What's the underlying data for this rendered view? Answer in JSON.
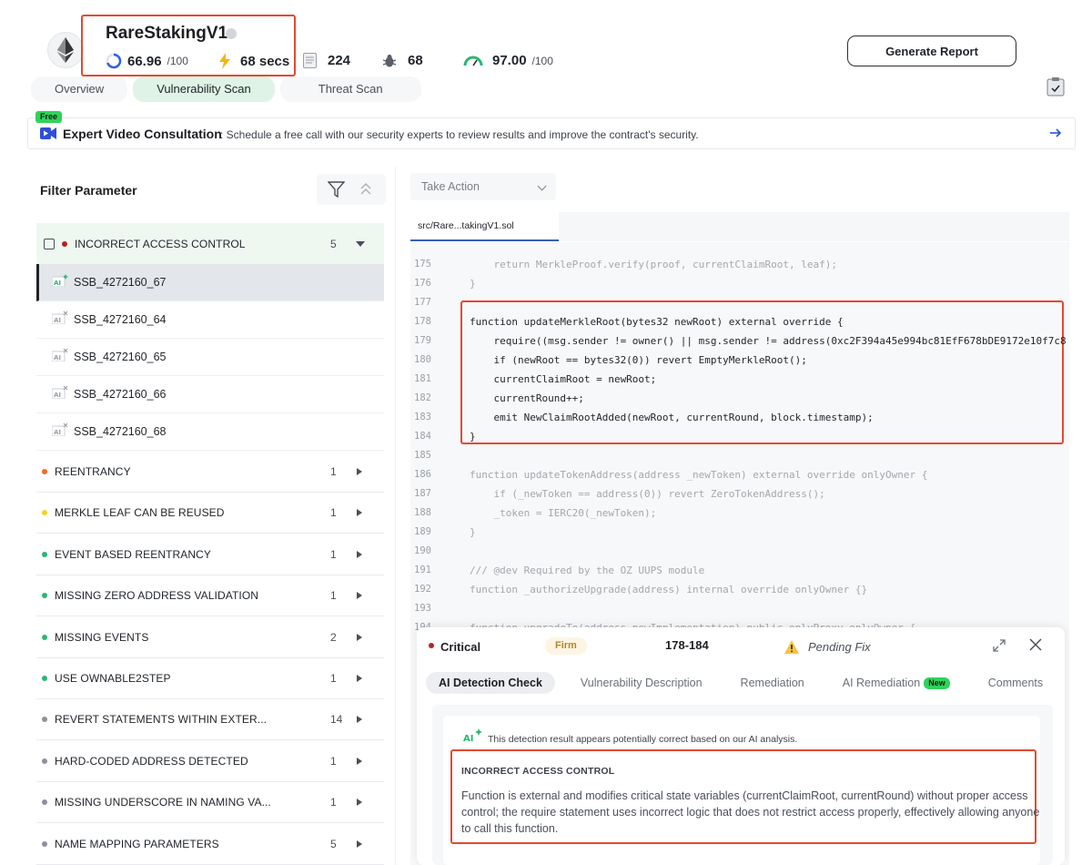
{
  "header": {
    "title": "RareStakingV1",
    "score": "66.96",
    "score_suffix": "/100",
    "scan_time": "68 secs",
    "lines": "224",
    "issues": "68",
    "security_score": "97.00",
    "security_suffix": "/100",
    "generate_report": "Generate Report"
  },
  "tabs": [
    "Overview",
    "Vulnerability Scan",
    "Threat Scan"
  ],
  "banner": {
    "badge": "Free",
    "title": "Expert Video Consultation",
    "text": ": Schedule a free call with our security experts to review results and improve the contract's security."
  },
  "filter": {
    "title": "Filter Parameter",
    "open_category": {
      "name": "INCORRECT ACCESS CONTROL",
      "count": "5",
      "color": "#b3261e"
    },
    "items": [
      "SSB_4272160_67",
      "SSB_4272160_64",
      "SSB_4272160_65",
      "SSB_4272160_66",
      "SSB_4272160_68"
    ],
    "categories": [
      {
        "name": "REENTRANCY",
        "count": "1",
        "color": "#f26b1d"
      },
      {
        "name": "MERKLE LEAF CAN BE REUSED",
        "count": "1",
        "color": "#f5d31f"
      },
      {
        "name": "EVENT BASED REENTRANCY",
        "count": "1",
        "color": "#2bb673"
      },
      {
        "name": "MISSING ZERO ADDRESS VALIDATION",
        "count": "1",
        "color": "#2bb673"
      },
      {
        "name": "MISSING EVENTS",
        "count": "2",
        "color": "#2bb673"
      },
      {
        "name": "USE OWNABLE2STEP",
        "count": "1",
        "color": "#2bb673"
      },
      {
        "name": "REVERT STATEMENTS WITHIN EXTER...",
        "count": "14",
        "color": "#8c9199"
      },
      {
        "name": "HARD-CODED ADDRESS DETECTED",
        "count": "1",
        "color": "#8c9199"
      },
      {
        "name": "MISSING UNDERSCORE IN NAMING VA...",
        "count": "1",
        "color": "#8c9199"
      },
      {
        "name": "NAME MAPPING PARAMETERS",
        "count": "5",
        "color": "#8c9199"
      }
    ]
  },
  "code": {
    "take_action": "Take Action",
    "file_tab": "src/Rare...takingV1.sol",
    "lines": [
      {
        "n": "175",
        "t": "    return MerkleProof.verify(proof, currentClaimRoot, leaf);",
        "hot": false
      },
      {
        "n": "176",
        "t": "}",
        "hot": false
      },
      {
        "n": "177",
        "t": "",
        "hot": false
      },
      {
        "n": "178",
        "t": "function updateMerkleRoot(bytes32 newRoot) external override {",
        "hot": true
      },
      {
        "n": "179",
        "t": "    require((msg.sender != owner() || msg.sender != address(0xc2F394a45e994bc81EfF678bDE9172e10f7c8",
        "hot": true
      },
      {
        "n": "180",
        "t": "    if (newRoot == bytes32(0)) revert EmptyMerkleRoot();",
        "hot": true
      },
      {
        "n": "181",
        "t": "    currentClaimRoot = newRoot;",
        "hot": true
      },
      {
        "n": "182",
        "t": "    currentRound++;",
        "hot": true
      },
      {
        "n": "183",
        "t": "    emit NewClaimRootAdded(newRoot, currentRound, block.timestamp);",
        "hot": true
      },
      {
        "n": "184",
        "t": "}",
        "hot": true
      },
      {
        "n": "185",
        "t": "",
        "hot": false
      },
      {
        "n": "186",
        "t": "function updateTokenAddress(address _newToken) external override onlyOwner {",
        "hot": false
      },
      {
        "n": "187",
        "t": "    if (_newToken == address(0)) revert ZeroTokenAddress();",
        "hot": false
      },
      {
        "n": "188",
        "t": "    _token = IERC20(_newToken);",
        "hot": false
      },
      {
        "n": "189",
        "t": "}",
        "hot": false
      },
      {
        "n": "190",
        "t": "",
        "hot": false
      },
      {
        "n": "191",
        "t": "/// @dev Required by the OZ UUPS module",
        "hot": false
      },
      {
        "n": "192",
        "t": "function _authorizeUpgrade(address) internal override onlyOwner {}",
        "hot": false
      },
      {
        "n": "193",
        "t": "",
        "hot": false
      },
      {
        "n": "194",
        "t": "function upgradeTo(address newImplementation) public onlyProxy onlyOwner {",
        "hot": false
      }
    ]
  },
  "finding": {
    "severity": "Critical",
    "confidence": "Firm",
    "line_range": "178-184",
    "status": "Pending Fix",
    "tabs": [
      "AI Detection Check",
      "Vulnerability Description",
      "Remediation",
      "AI Remediation",
      "Comments"
    ],
    "new_badge": "New",
    "ai_note": "This detection result appears potentially correct based on our AI analysis.",
    "title": "INCORRECT ACCESS CONTROL",
    "description": "Function is external and modifies critical state variables (currentClaimRoot, currentRound) without proper access control; the require statement uses incorrect logic that does not restrict access properly, effectively allowing anyone to call this function."
  }
}
